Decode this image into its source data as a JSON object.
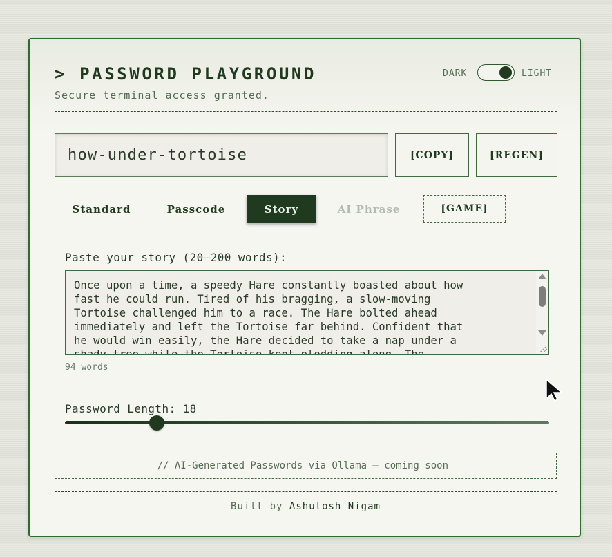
{
  "header": {
    "title": "> PASSWORD PLAYGROUND",
    "subtitle": "Secure terminal access granted.",
    "theme_toggle": {
      "dark_label": "DARK",
      "light_label": "LIGHT"
    }
  },
  "password": {
    "value": "how-under-tortoise",
    "copy_label": "[COPY]",
    "regen_label": "[REGEN]"
  },
  "tabs": [
    {
      "label": "Standard"
    },
    {
      "label": "Passcode"
    },
    {
      "label": "Story"
    },
    {
      "label": "AI Phrase"
    },
    {
      "label": "[GAME]"
    }
  ],
  "story": {
    "label": "Paste your story (20–200 words):",
    "text": "Once upon a time, a speedy Hare constantly boasted about how\nfast he could run. Tired of his bragging, a slow-moving\nTortoise challenged him to a race. The Hare bolted ahead\nimmediately and left the Tortoise far behind. Confident that\nhe would win easily, the Hare decided to take a nap under a\nshady tree while the Tortoise kept plodding along. The",
    "word_count": "94 words"
  },
  "length": {
    "label": "Password Length:",
    "value": "18",
    "slider_fraction": 0.19
  },
  "banner": {
    "text": "// AI-Generated Passwords via Ollama — coming soon_"
  },
  "footer": {
    "prefix": "Built by",
    "author": "Ashutosh Nigam"
  },
  "colors": {
    "accent": "#1f3a1f",
    "border": "#2f6a2f",
    "panel": "#f6f6f1",
    "muted": "#556b55"
  }
}
